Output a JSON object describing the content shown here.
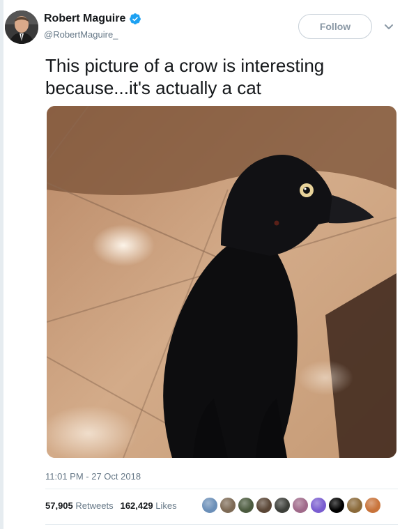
{
  "author": {
    "name": "Robert Maguire",
    "handle": "@RobertMaguire_"
  },
  "follow_label": "Follow",
  "tweet": {
    "line1": "This picture of a crow is interesting",
    "line2": "because...it's actually a cat"
  },
  "timestamp": "11:01 PM - 27 Oct 2018",
  "stats": {
    "retweets_count": "57,905",
    "retweets_label": "Retweets",
    "likes_count": "162,429",
    "likes_label": "Likes"
  },
  "colors": {
    "verified": "#1da1f2",
    "secondary_text": "#657786",
    "divider": "#e6ecf0"
  },
  "likers": [
    {
      "color": "#6b8fb8"
    },
    {
      "color": "#7d6a55"
    },
    {
      "color": "#4b5a3e"
    },
    {
      "color": "#5a4636"
    },
    {
      "color": "#3d3f3a"
    },
    {
      "color": "#a06a8a"
    },
    {
      "color": "#7a5dd0"
    },
    {
      "color": "#000000"
    },
    {
      "color": "#8b6a3a"
    },
    {
      "color": "#c8733a"
    }
  ]
}
